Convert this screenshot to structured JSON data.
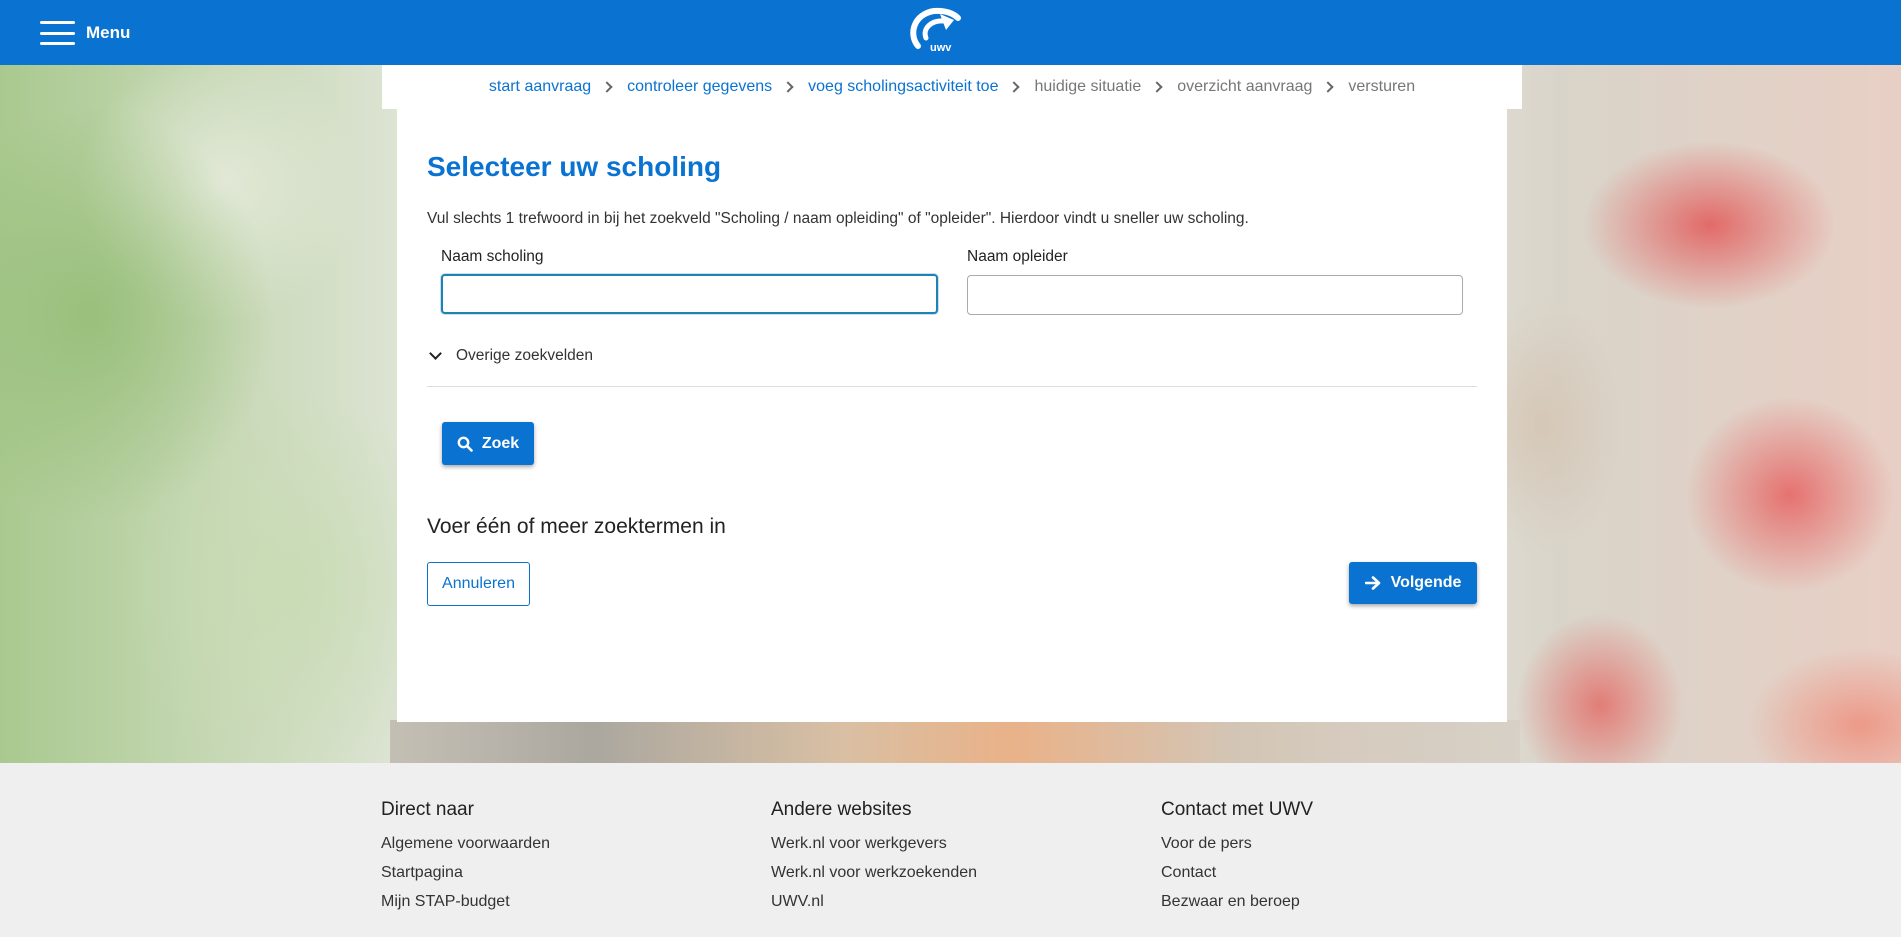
{
  "header": {
    "menu_label": "Menu",
    "logo_text": "uwv",
    "brand_color": "#0a73d2"
  },
  "breadcrumb": [
    {
      "label": "start aanvraag",
      "state": "done"
    },
    {
      "label": "controleer gegevens",
      "state": "done"
    },
    {
      "label": "voeg scholingsactiviteit toe",
      "state": "current"
    },
    {
      "label": "huidige situatie",
      "state": "todo"
    },
    {
      "label": "overzicht aanvraag",
      "state": "todo"
    },
    {
      "label": "versturen",
      "state": "todo"
    }
  ],
  "main": {
    "title": "Selecteer uw scholing",
    "intro": "Vul slechts 1 trefwoord in bij het zoekveld \"Scholing / naam opleiding\" of \"opleider\". Hierdoor vindt u sneller uw scholing.",
    "fields": {
      "naam_scholing": {
        "label": "Naam scholing",
        "value": ""
      },
      "naam_opleider": {
        "label": "Naam opleider",
        "value": ""
      }
    },
    "toggle_label": "Overige zoekvelden",
    "search_button": "Zoek",
    "results_heading": "Voer één of meer zoektermen in",
    "cancel_button": "Annuleren",
    "next_button": "Volgende"
  },
  "footer": {
    "columns": [
      {
        "title": "Direct naar",
        "links": [
          "Algemene voorwaarden",
          "Startpagina",
          "Mijn STAP-budget"
        ]
      },
      {
        "title": "Andere websites",
        "links": [
          "Werk.nl voor werkgevers",
          "Werk.nl voor werkzoekenden",
          "UWV.nl"
        ]
      },
      {
        "title": "Contact met UWV",
        "links": [
          "Voor de pers",
          "Contact",
          "Bezwaar en beroep"
        ]
      }
    ]
  }
}
